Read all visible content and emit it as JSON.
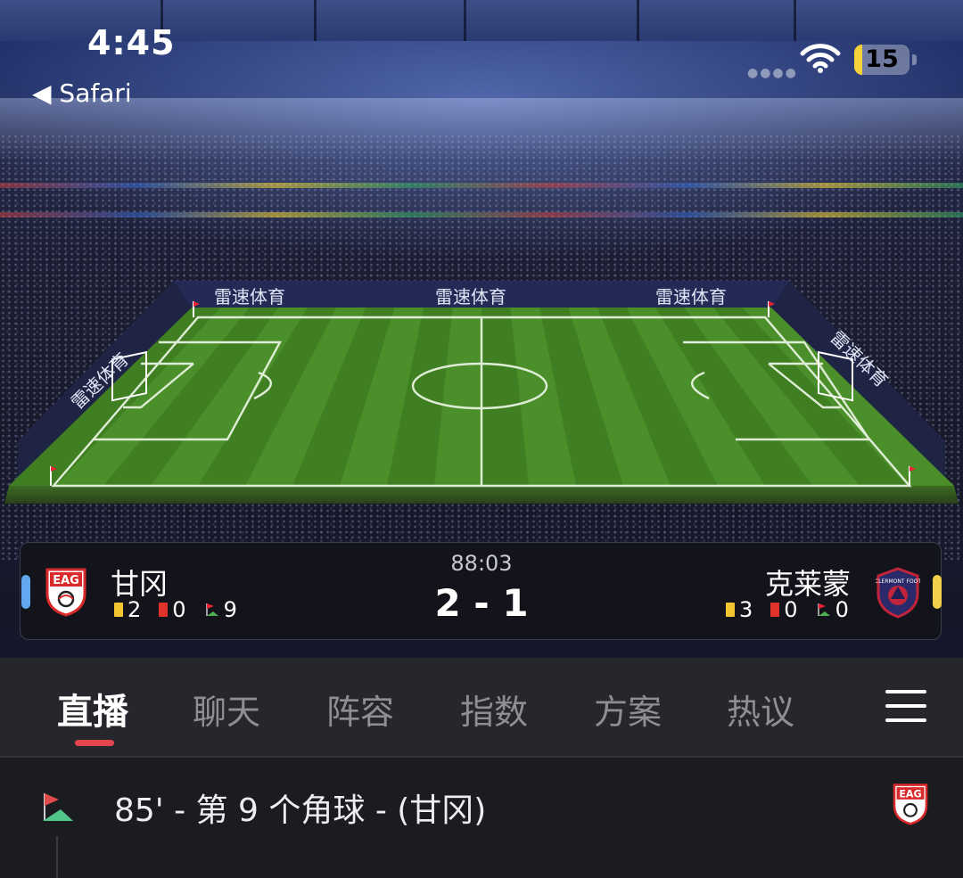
{
  "status_bar": {
    "time": "4:45",
    "back_label": "◀ Safari",
    "battery": "15",
    "battery_level": 0.15
  },
  "pitch": {
    "brand": "雷速体育"
  },
  "match": {
    "minute": "88:03",
    "score": "2 - 1",
    "home": {
      "name": "甘冈",
      "crest_text": "EAG",
      "accent_color": "#62a8f0",
      "yellow_cards": "2",
      "red_cards": "0",
      "corners": "9"
    },
    "away": {
      "name": "克莱蒙",
      "accent_color": "#f2d04a",
      "yellow_cards": "3",
      "red_cards": "0",
      "corners": "0"
    }
  },
  "tabs": [
    {
      "label": "直播",
      "active": true
    },
    {
      "label": "聊天"
    },
    {
      "label": "阵容"
    },
    {
      "label": "指数"
    },
    {
      "label": "方案"
    },
    {
      "label": "热议"
    }
  ],
  "events": [
    {
      "text": "85' - 第 9 个角球 - (甘冈)",
      "icon": "corner-flag-icon",
      "team_crest_text": "EAG"
    }
  ],
  "colors": {
    "accent": "#e4454e",
    "pitch": "#4a8f2a"
  }
}
